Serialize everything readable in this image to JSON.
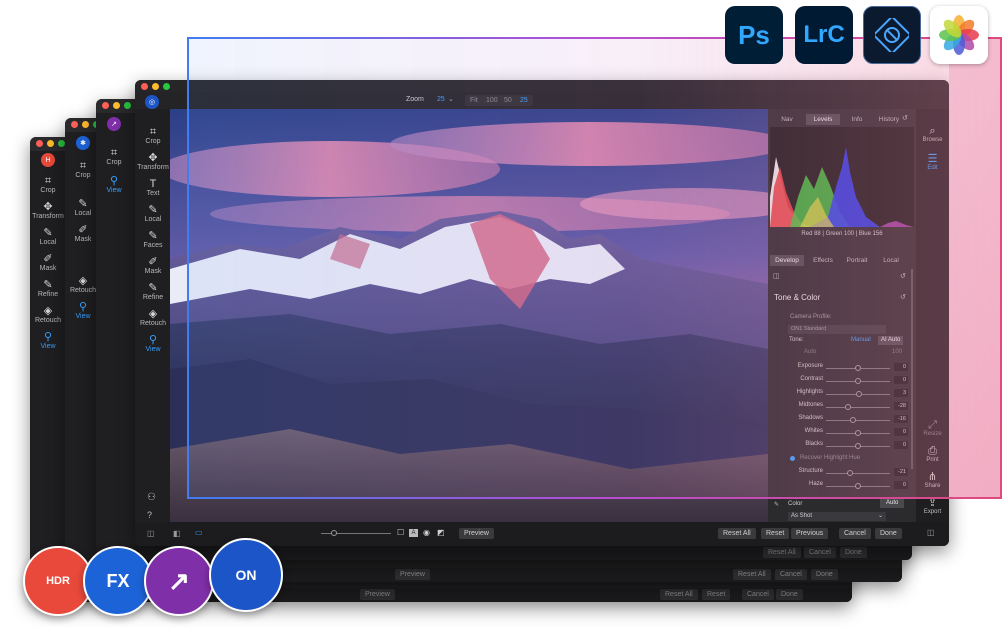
{
  "product_icons": [
    {
      "name": "photoshop-icon",
      "text": "Ps",
      "bg": "#001e36",
      "fg": "#31a8ff"
    },
    {
      "name": "lightroom-classic-icon",
      "text": "LrC",
      "bg": "#001a33",
      "fg": "#31a8ff"
    },
    {
      "name": "photoshop-elements-icon",
      "text": "",
      "bg": "#0b1a2e",
      "fg": "#4aa7ff"
    },
    {
      "name": "apple-photos-icon",
      "text": "",
      "bg": "#ffffff",
      "fg": "#000000"
    }
  ],
  "badges": [
    {
      "name": "hdr-badge",
      "text": "HDR",
      "bg": "#e8493a"
    },
    {
      "name": "fx-badge",
      "text": "FX",
      "bg": "#1d63d8"
    },
    {
      "name": "resize-badge",
      "text": "↗",
      "bg": "#7f2fa8"
    },
    {
      "name": "on1-badge",
      "text": "ON",
      "bg": "#1c55c7"
    }
  ],
  "back_windows": {
    "w1_tools": [
      "Crop",
      "Transform",
      "Local",
      "Mask",
      "Refine",
      "Retouch",
      "View"
    ],
    "w2_tools": [
      "Crop",
      "Local",
      "Mask",
      "Retouch",
      "View"
    ],
    "w3_tools": [
      "Crop",
      "View"
    ],
    "bar_row1": [
      "Reset All",
      "Cancel",
      "Done"
    ],
    "bar_row2_preview": "Preview",
    "bar_row2": [
      "Reset All",
      "Cancel",
      "Done"
    ],
    "bar_row3_preview": "Preview",
    "bar_row3": [
      "Reset All",
      "Reset",
      "Cancel",
      "Done"
    ]
  },
  "main": {
    "left_tools": [
      "Crop",
      "Transform",
      "Text",
      "Local",
      "Faces",
      "Mask",
      "Refine",
      "Retouch",
      "View"
    ],
    "active_tool": "View",
    "zoom_label": "Zoom",
    "zoom_value": "25",
    "zoom_buttons": [
      "Fit",
      "100",
      "50",
      "25"
    ],
    "panel_tabs": [
      "Nav",
      "Levels",
      "Info",
      "History"
    ],
    "active_panel_tab": "Levels",
    "rgb_readout": "Red  88  |  Green  100  |  Blue  156",
    "develop_tabs": [
      "Develop",
      "Effects",
      "Portrait",
      "Local"
    ],
    "active_develop_tab": "Develop",
    "section_title": "Tone & Color",
    "camera_profile_label": "Camera Profile:",
    "camera_profile_value": "ON1 Standard",
    "tone_label": "Tone:",
    "tone_modes": [
      "Manual",
      "AI Auto"
    ],
    "auto_label": "Auto",
    "auto_value": "100",
    "sliders": [
      {
        "label": "Exposure",
        "value": "0",
        "pos": 0.5
      },
      {
        "label": "Contrast",
        "value": "0",
        "pos": 0.5
      },
      {
        "label": "Highlights",
        "value": "3",
        "pos": 0.52
      },
      {
        "label": "Midtones",
        "value": "-28",
        "pos": 0.35
      },
      {
        "label": "Shadows",
        "value": "-16",
        "pos": 0.42
      },
      {
        "label": "Whites",
        "value": "0",
        "pos": 0.5
      },
      {
        "label": "Blacks",
        "value": "0",
        "pos": 0.5
      }
    ],
    "recover_label": "Recover Highlight Hue",
    "sliders2": [
      {
        "label": "Structure",
        "value": "-21",
        "pos": 0.38
      },
      {
        "label": "Haze",
        "value": "0",
        "pos": 0.5
      }
    ],
    "color_label": "Color",
    "color_auto": "Auto",
    "white_balance": "As Shot",
    "right_rail": [
      "Browse",
      "Edit",
      "Resize",
      "Print",
      "Share",
      "Export"
    ],
    "active_rail": "Edit",
    "bottom_preview": "Preview",
    "bottom_buttons": [
      "Reset All",
      "Reset",
      "Previous",
      "Cancel",
      "Done"
    ]
  }
}
